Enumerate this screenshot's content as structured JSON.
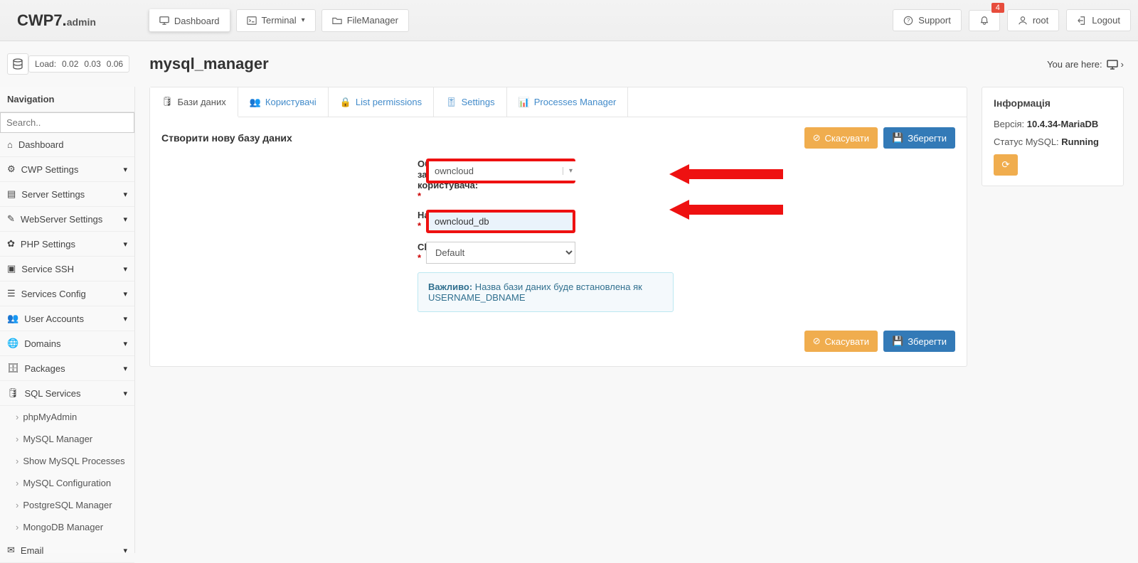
{
  "brand": {
    "main": "CWP7.",
    "suffix": "admin"
  },
  "topbar": {
    "dashboard": "Dashboard",
    "terminal": "Terminal",
    "filemanager": "FileManager",
    "support": "Support",
    "root": "root",
    "logout": "Logout",
    "badge": "4"
  },
  "load": {
    "label": "Load:",
    "v1": "0.02",
    "v2": "0.03",
    "v3": "0.06"
  },
  "page": {
    "title": "mysql_manager",
    "you_are_here": "You are here:"
  },
  "nav": {
    "title": "Navigation",
    "search_placeholder": "Search..",
    "items": [
      "Dashboard",
      "CWP Settings",
      "Server Settings",
      "WebServer Settings",
      "PHP Settings",
      "Service SSH",
      "Services Config",
      "User Accounts",
      "Domains",
      "Packages",
      "SQL Services"
    ],
    "sql_sub": [
      "phpMyAdmin",
      "MySQL Manager",
      "Show MySQL Processes",
      "MySQL Configuration",
      "PostgreSQL Manager",
      "MongoDB Manager"
    ],
    "last": "Email"
  },
  "tabs": {
    "databases": "Бази даних",
    "users": "Користувачі",
    "listperm": "List permissions",
    "settings": "Settings",
    "procmgr": "Processes Manager"
  },
  "form": {
    "heading": "Створити нову базу даних",
    "cancel": "Скасувати",
    "save": "Зберегти",
    "account_label": "Обліковий запис користувача:",
    "account_value": "owncloud",
    "name_label": "Назва:",
    "name_value": "owncloud_db",
    "charset_label": "Charset:",
    "charset_value": "Default",
    "alert_strong": "Важливо:",
    "alert_text": " Назва бази даних буде встановлена як USERNAME_DBNAME"
  },
  "info": {
    "title": "Інформація",
    "version_label": "Версія: ",
    "version_value": "10.4.34-MariaDB",
    "status_label": "Статус MySQL: ",
    "status_value": "Running"
  }
}
